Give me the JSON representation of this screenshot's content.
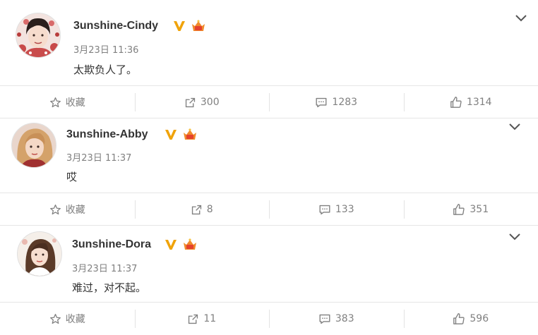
{
  "posts": [
    {
      "username": "3unshine-Cindy",
      "timestamp": "3月23日 11:36",
      "content": "太欺负人了。",
      "actions": {
        "favorite_label": "收藏",
        "repost_count": "300",
        "comment_count": "1283",
        "like_count": "1314"
      }
    },
    {
      "username": "3unshine-Abby",
      "timestamp": "3月23日 11:37",
      "content": "哎",
      "actions": {
        "favorite_label": "收藏",
        "repost_count": "8",
        "comment_count": "133",
        "like_count": "351"
      }
    },
    {
      "username": "3unshine-Dora",
      "timestamp": "3月23日 11:37",
      "content": "难过，对不起。",
      "actions": {
        "favorite_label": "收藏",
        "repost_count": "11",
        "comment_count": "383",
        "like_count": "596"
      }
    }
  ],
  "icons": {
    "verified": "verified-v-icon",
    "member_crown": "member-crown-icon",
    "favorite": "star-outline-icon",
    "repost": "repost-arrow-icon",
    "comment": "comment-bubble-icon",
    "like": "thumbs-up-icon",
    "expand": "chevron-down-icon"
  },
  "colors": {
    "verified_gold": "#f0a30a",
    "crown_orange": "#f08a2c",
    "text_primary": "#333333",
    "text_secondary": "#808080",
    "divider": "#e6e6e6"
  }
}
